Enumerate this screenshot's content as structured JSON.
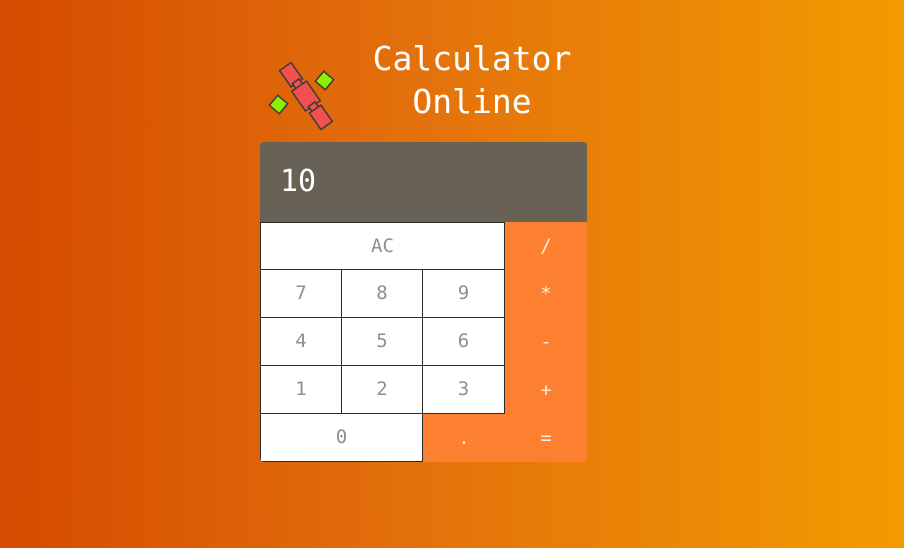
{
  "header": {
    "logo_icon": "calculator-tools-logo-icon",
    "title_line1": "Calculator",
    "title_line2": "Online"
  },
  "display": {
    "value": "10"
  },
  "keys": {
    "clear": "AC",
    "divide": "/",
    "seven": "7",
    "eight": "8",
    "nine": "9",
    "multiply": "*",
    "four": "4",
    "five": "5",
    "six": "6",
    "subtract": "-",
    "one": "1",
    "two": "2",
    "three": "3",
    "add": "+",
    "zero": "0",
    "decimal": ".",
    "equals": "="
  },
  "colors": {
    "display_bg": "#686156",
    "operator_bg": "#fd8031",
    "digit_bg": "#ffffff",
    "logo_red": "#f25050",
    "logo_green": "#8cee00"
  }
}
